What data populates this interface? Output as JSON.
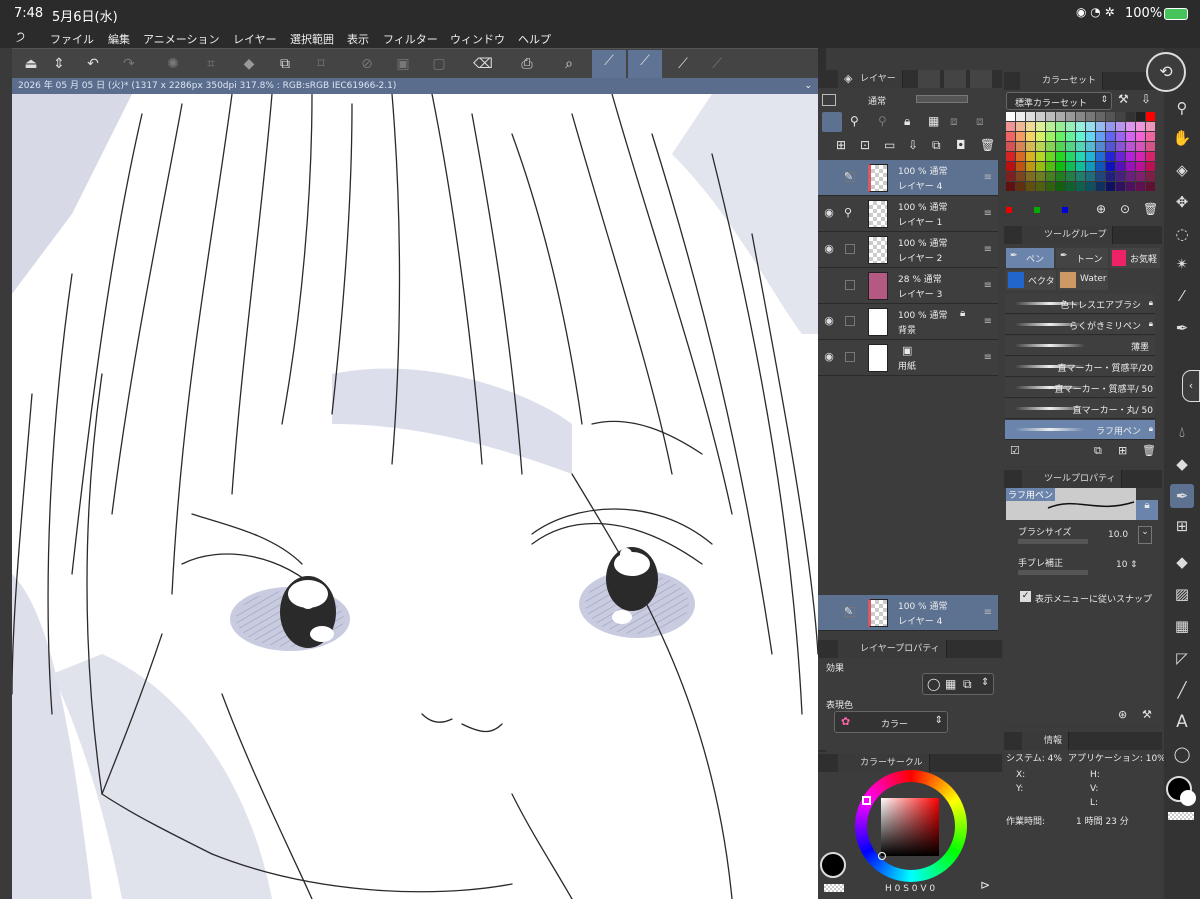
{
  "status": {
    "time": "7:48",
    "date": "5月6日(水)",
    "battery": "100%"
  },
  "menu": [
    "ファイル",
    "編集",
    "アニメーション",
    "レイヤー",
    "選択範囲",
    "表示",
    "フィルター",
    "ウィンドウ",
    "ヘルプ"
  ],
  "doc_tab": "2026 年 05 月 05 日 (火)* (1317 x 2286px 350dpi 317.8% : RGB:sRGB IEC61966-2.1)",
  "layer_panel": {
    "tab1": "レイヤー",
    "blend": "通常",
    "layers": [
      {
        "opacity": "100 % 通常",
        "name": "レイヤー 4",
        "selected": true
      },
      {
        "opacity": "100 % 通常",
        "name": "レイヤー 1"
      },
      {
        "opacity": "100 % 通常",
        "name": "レイヤー 2"
      },
      {
        "opacity": "28 % 通常",
        "name": "レイヤー 3"
      },
      {
        "opacity": "100 % 通常",
        "name": "背景"
      },
      {
        "opacity": "",
        "name": "用紙"
      }
    ],
    "current": {
      "opacity": "100 % 通常",
      "name": "レイヤー 4"
    }
  },
  "layer_props": {
    "title": "レイヤープロパティ",
    "effect": "効果",
    "color_label": "表現色",
    "color_value": "カラー"
  },
  "color_circle": {
    "title": "カラーサークル",
    "hsv": "H 0 S 0 V 0"
  },
  "color_set": {
    "title": "カラーセット",
    "set_name": "標準カラーセット"
  },
  "tool_group": {
    "title": "ツールグループ",
    "tabs": [
      "ペン",
      "トーン",
      "お気軽",
      "ベクタ",
      "Water"
    ],
    "brushes": [
      "色トレスエアブラシ",
      "らくがきミリペン",
      "薄墨",
      "直マーカー・質感平/20",
      "直マーカー・質感平/ 50",
      "直マーカー・丸/ 50",
      "ラフ用ペン"
    ]
  },
  "tool_prop": {
    "title": "ツールプロパティ",
    "tool_name": "ラフ用ペン",
    "brush_size_label": "ブラシサイズ",
    "brush_size": "10.0",
    "stab_label": "手ブレ補正",
    "stab": "10",
    "snap": "表示メニューに従いスナップ"
  },
  "info": {
    "title": "情報",
    "system": "システム: 4%",
    "app": "アプリケーション: 10%",
    "x": "X:",
    "y": "Y:",
    "h": "H:",
    "v": "V:",
    "l": "L:",
    "work_label": "作業時間:",
    "work_time": "1 時間 23 分"
  },
  "colors": {
    "accent": "#5d7191",
    "panel": "#3c3c3c",
    "main_color": "#000000"
  }
}
